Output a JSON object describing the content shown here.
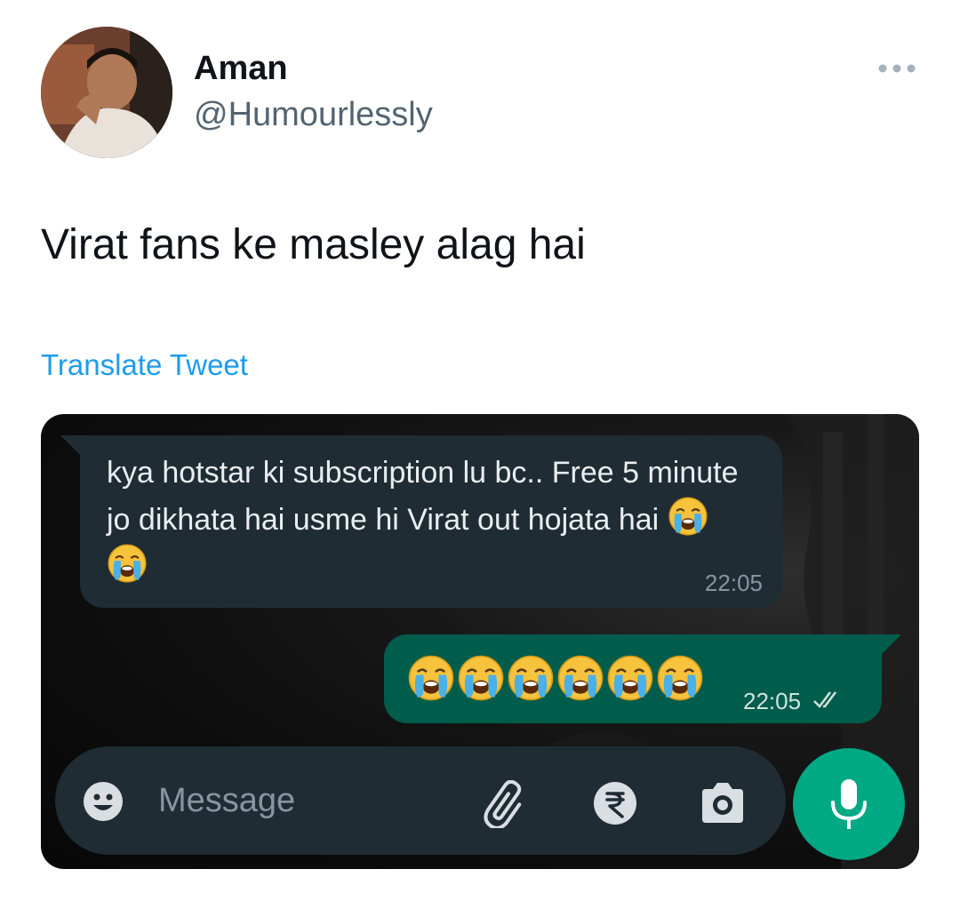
{
  "author": {
    "name": "Aman",
    "handle": "@Humourlessly"
  },
  "tweet": {
    "text": "Virat fans ke masley alag hai",
    "translate_label": "Translate Tweet"
  },
  "chat": {
    "incoming": {
      "text": "kya hotstar ki subscription lu bc.. Free 5 minute jo dikhata hai usme hi Virat out hojata hai",
      "emoji_count": 2,
      "time": "22:05"
    },
    "outgoing": {
      "emoji_count": 6,
      "time": "22:05",
      "status": "read"
    },
    "input": {
      "placeholder": "Message"
    }
  },
  "icons": {
    "more": "more-horizontal-icon",
    "emoji": "smiley-icon",
    "attach": "paperclip-icon",
    "payment": "rupee-icon",
    "camera": "camera-icon",
    "mic": "microphone-icon",
    "read_receipt": "double-check-icon"
  },
  "colors": {
    "twitter_blue": "#1d9bf0",
    "bubble_in": "#1f2c34",
    "bubble_out": "#005c4b",
    "mic_green": "#00a884"
  }
}
